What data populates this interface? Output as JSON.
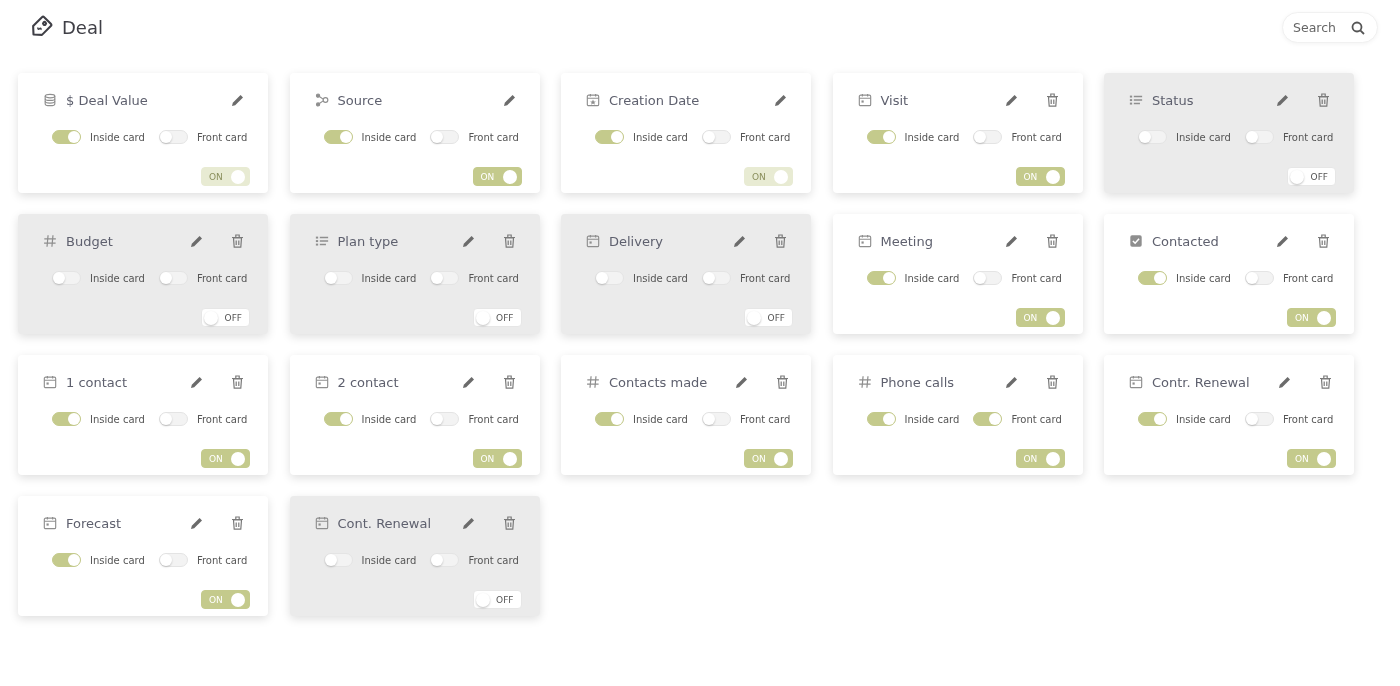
{
  "header": {
    "title": "Deal"
  },
  "search": {
    "placeholder": "Search"
  },
  "cards": [
    {
      "title": "$ Deal Value",
      "kind": "currency",
      "deletable": false,
      "toggles": [
        {
          "label": "Inside card",
          "on": true
        },
        {
          "label": "Front card",
          "on": false
        }
      ],
      "status": {
        "label": "ON",
        "on": true,
        "disabled": true
      }
    },
    {
      "title": "Source",
      "kind": "source",
      "deletable": false,
      "toggles": [
        {
          "label": "Inside card",
          "on": true
        },
        {
          "label": "Front card",
          "on": false
        }
      ],
      "status": {
        "label": "ON",
        "on": true,
        "disabled": false
      }
    },
    {
      "title": "Creation Date",
      "kind": "created",
      "deletable": false,
      "toggles": [
        {
          "label": "Inside card",
          "on": true
        },
        {
          "label": "Front card",
          "on": false
        }
      ],
      "status": {
        "label": "ON",
        "on": true,
        "disabled": true
      }
    },
    {
      "title": "Visit",
      "kind": "date",
      "deletable": true,
      "toggles": [
        {
          "label": "Inside card",
          "on": true
        },
        {
          "label": "Front card",
          "on": false
        }
      ],
      "status": {
        "label": "ON",
        "on": true,
        "disabled": false
      }
    },
    {
      "title": "Status",
      "kind": "list",
      "deletable": true,
      "toggles": [
        {
          "label": "Inside card",
          "on": false
        },
        {
          "label": "Front card",
          "on": false
        }
      ],
      "status": {
        "label": "OFF",
        "on": false,
        "disabled": false
      }
    },
    {
      "title": "Budget",
      "kind": "number",
      "deletable": true,
      "toggles": [
        {
          "label": "Inside card",
          "on": false
        },
        {
          "label": "Front card",
          "on": false
        }
      ],
      "status": {
        "label": "OFF",
        "on": false,
        "disabled": false
      }
    },
    {
      "title": "Plan type",
      "kind": "list",
      "deletable": true,
      "toggles": [
        {
          "label": "Inside card",
          "on": false
        },
        {
          "label": "Front card",
          "on": false
        }
      ],
      "status": {
        "label": "OFF",
        "on": false,
        "disabled": false
      }
    },
    {
      "title": "Delivery",
      "kind": "date",
      "deletable": true,
      "toggles": [
        {
          "label": "Inside card",
          "on": false
        },
        {
          "label": "Front card",
          "on": false
        }
      ],
      "status": {
        "label": "OFF",
        "on": false,
        "disabled": false
      }
    },
    {
      "title": "Meeting",
      "kind": "date",
      "deletable": true,
      "toggles": [
        {
          "label": "Inside card",
          "on": true
        },
        {
          "label": "Front card",
          "on": false
        }
      ],
      "status": {
        "label": "ON",
        "on": true,
        "disabled": false
      }
    },
    {
      "title": "Contacted",
      "kind": "checkbox",
      "deletable": true,
      "toggles": [
        {
          "label": "Inside card",
          "on": true
        },
        {
          "label": "Front card",
          "on": false
        }
      ],
      "status": {
        "label": "ON",
        "on": true,
        "disabled": false
      }
    },
    {
      "title": "1 contact",
      "kind": "date",
      "deletable": true,
      "toggles": [
        {
          "label": "Inside card",
          "on": true
        },
        {
          "label": "Front card",
          "on": false
        }
      ],
      "status": {
        "label": "ON",
        "on": true,
        "disabled": false
      }
    },
    {
      "title": "2 contact",
      "kind": "date",
      "deletable": true,
      "toggles": [
        {
          "label": "Inside card",
          "on": true
        },
        {
          "label": "Front card",
          "on": false
        }
      ],
      "status": {
        "label": "ON",
        "on": true,
        "disabled": false
      }
    },
    {
      "title": "Contacts made",
      "kind": "number",
      "deletable": true,
      "toggles": [
        {
          "label": "Inside card",
          "on": true
        },
        {
          "label": "Front card",
          "on": false
        }
      ],
      "status": {
        "label": "ON",
        "on": true,
        "disabled": false
      }
    },
    {
      "title": "Phone calls",
      "kind": "number",
      "deletable": true,
      "toggles": [
        {
          "label": "Inside card",
          "on": true
        },
        {
          "label": "Front card",
          "on": true
        }
      ],
      "status": {
        "label": "ON",
        "on": true,
        "disabled": false
      }
    },
    {
      "title": "Contr. Renewal",
      "kind": "date",
      "deletable": true,
      "toggles": [
        {
          "label": "Inside card",
          "on": true
        },
        {
          "label": "Front card",
          "on": false
        }
      ],
      "status": {
        "label": "ON",
        "on": true,
        "disabled": false
      }
    },
    {
      "title": "Forecast",
      "kind": "date",
      "deletable": true,
      "toggles": [
        {
          "label": "Inside card",
          "on": true
        },
        {
          "label": "Front card",
          "on": false
        }
      ],
      "status": {
        "label": "ON",
        "on": true,
        "disabled": false
      }
    },
    {
      "title": "Cont. Renewal",
      "kind": "date",
      "deletable": true,
      "toggles": [
        {
          "label": "Inside card",
          "on": false
        },
        {
          "label": "Front card",
          "on": false
        }
      ],
      "status": {
        "label": "OFF",
        "on": false,
        "disabled": false
      }
    }
  ]
}
